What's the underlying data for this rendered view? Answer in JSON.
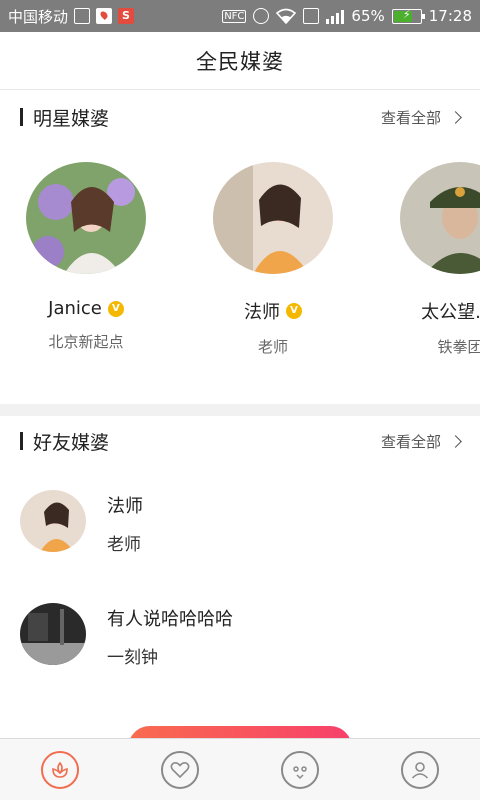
{
  "status_bar": {
    "carrier": "中国移动",
    "battery_percent": "65%",
    "battery_level": 0.65,
    "time": "17:28",
    "icons": [
      "image-icon",
      "map-icon",
      "sogou-icon",
      "nfc-icon",
      "alarm-icon",
      "wifi-icon",
      "sim-icon",
      "signal-icon",
      "battery-icon"
    ]
  },
  "header": {
    "title": "全民媒婆"
  },
  "star_section": {
    "title": "明星媒婆",
    "view_all": "查看全部",
    "items": [
      {
        "name": "Janice",
        "subtitle": "北京新起点",
        "verified": true
      },
      {
        "name": "法师",
        "subtitle": "老师",
        "verified": true
      },
      {
        "name": "太公望.盛",
        "subtitle": "铁拳团",
        "verified": false
      }
    ]
  },
  "friend_section": {
    "title": "好友媒婆",
    "view_all": "查看全部",
    "items": [
      {
        "name": "法师",
        "subtitle": "老师"
      },
      {
        "name": "有人说哈哈哈哈",
        "subtitle": "一刻钟"
      }
    ]
  },
  "tab_bar": {
    "tabs": [
      {
        "icon": "flower-icon",
        "active": true
      },
      {
        "icon": "heart-icon",
        "active": false
      },
      {
        "icon": "chat-icon",
        "active": false
      },
      {
        "icon": "profile-icon",
        "active": false
      }
    ]
  },
  "colors": {
    "accent": "#f06d4f",
    "cta_start": "#f96b4e",
    "cta_end": "#f7406b",
    "verified": "#f5b800"
  }
}
